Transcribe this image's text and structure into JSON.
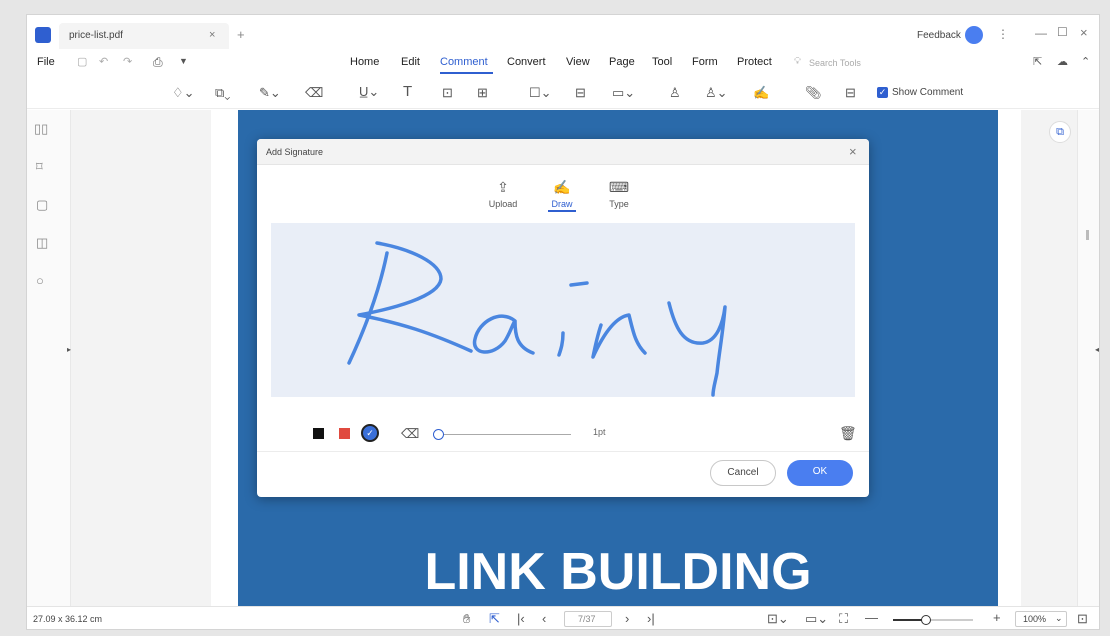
{
  "window": {
    "tab_title": "price-list.pdf",
    "feedback": "Feedback"
  },
  "menu": {
    "file": "File",
    "items": [
      "Home",
      "Edit",
      "Comment",
      "Convert",
      "View",
      "Page",
      "Tool",
      "Form",
      "Protect"
    ],
    "active": "Comment",
    "search_placeholder": "Search Tools"
  },
  "toolbar": {
    "show_comment": "Show Comment"
  },
  "page": {
    "title": "LINK BUILDING",
    "accent": "#2a6aaa"
  },
  "dialog": {
    "title": "Add Signature",
    "tabs": [
      "Upload",
      "Draw",
      "Type"
    ],
    "active_tab": "Draw",
    "signature_text": "Rainy",
    "stroke_label": "1pt",
    "cancel": "Cancel",
    "ok": "OK",
    "colors": [
      "#111111",
      "#e04a3f",
      "#3a6fd8"
    ]
  },
  "status": {
    "dimensions": "27.09 x 36.12 cm",
    "page_indicator": "7/37",
    "zoom": "100%"
  }
}
